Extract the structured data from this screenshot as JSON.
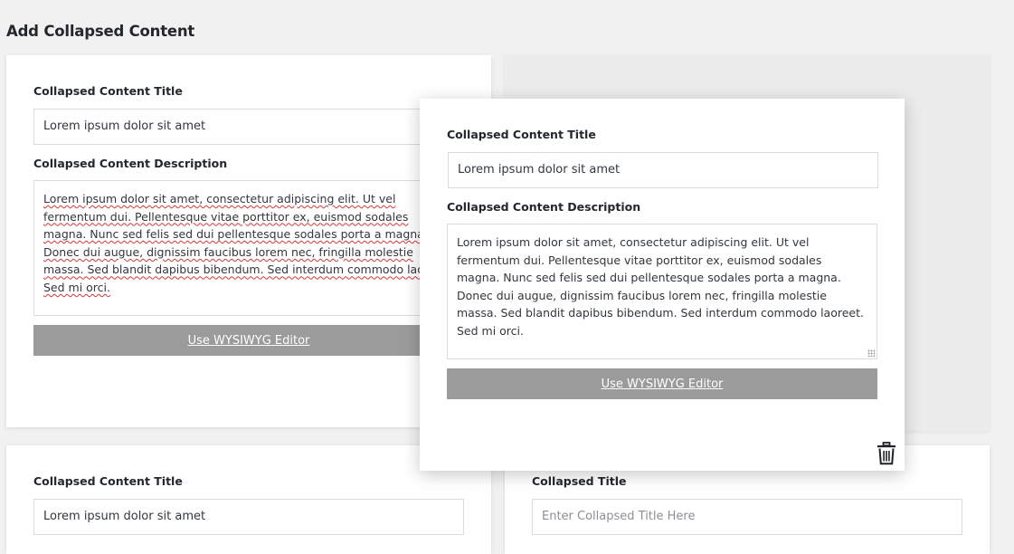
{
  "page": {
    "heading": "Add Collapsed Content"
  },
  "item1": {
    "title_label": "Collapsed Content Title",
    "title_value": "Lorem ipsum dolor sit amet",
    "description_label": "Collapsed Content Description",
    "description_value": "Lorem ipsum dolor sit amet, consectetur adipiscing elit. Ut vel fermentum dui. Pellentesque vitae porttitor ex, euismod sodales magna. Nunc sed felis sed dui pellentesque sodales porta a magna. Donec dui augue, dignissim faucibus lorem nec, fringilla molestie massa. Sed blandit dapibus bibendum. Sed interdum commodo laoreet. Sed mi orci.",
    "wysiwyg_label": "Use WYSIWYG Editor"
  },
  "dragged_item": {
    "title_label": "Collapsed Content Title",
    "title_value": "Lorem ipsum dolor sit amet",
    "description_label": "Collapsed Content Description",
    "description_value": "Lorem ipsum dolor sit amet, consectetur adipiscing elit. Ut vel fermentum dui. Pellentesque vitae porttitor ex, euismod sodales magna. Nunc sed felis sed dui pellentesque sodales porta a magna. Donec dui augue, dignissim faucibus lorem nec, fringilla molestie massa. Sed blandit dapibus bibendum. Sed interdum commodo laoreet. Sed mi orci.",
    "wysiwyg_label": "Use WYSIWYG Editor",
    "delete_icon": "trash-icon"
  },
  "item3": {
    "title_label": "Collapsed Content Title",
    "title_value": "Lorem ipsum dolor sit amet"
  },
  "item4": {
    "title_label": "Collapsed Title",
    "title_placeholder": "Enter Collapsed Title Here"
  },
  "colors": {
    "background": "#f1f1f1",
    "card": "#ffffff",
    "placeholder_card": "#ececec",
    "button": "#9b9b9b",
    "text": "#23282d"
  }
}
